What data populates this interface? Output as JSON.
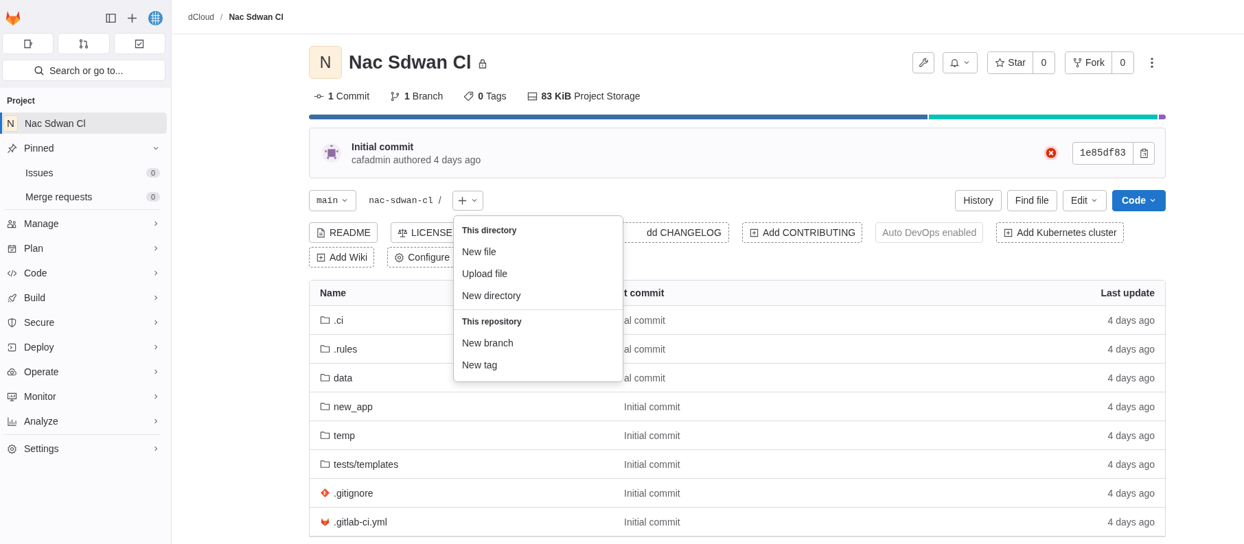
{
  "sidebar": {
    "search": {
      "placeholder": "Search or go to..."
    },
    "section": "Project",
    "project": {
      "initial": "N",
      "name": "Nac Sdwan Cl",
      "selected": true
    },
    "pinned": {
      "label": "Pinned",
      "expanded": true,
      "items": [
        {
          "label": "Issues",
          "count": "0"
        },
        {
          "label": "Merge requests",
          "count": "0"
        }
      ]
    },
    "groups": [
      {
        "label": "Manage"
      },
      {
        "label": "Plan"
      },
      {
        "label": "Code"
      },
      {
        "label": "Build"
      },
      {
        "label": "Secure"
      },
      {
        "label": "Deploy"
      },
      {
        "label": "Operate"
      },
      {
        "label": "Monitor"
      },
      {
        "label": "Analyze"
      }
    ],
    "settings": {
      "label": "Settings"
    }
  },
  "breadcrumb": {
    "items": [
      "dCloud",
      "Nac Sdwan Cl"
    ],
    "separator": "/"
  },
  "project": {
    "initial": "N",
    "name": "Nac Sdwan Cl",
    "private": true,
    "star": {
      "label": "Star",
      "count": "0"
    },
    "fork": {
      "label": "Fork",
      "count": "0"
    }
  },
  "stats": [
    {
      "count": "1",
      "label": "Commit"
    },
    {
      "count": "1",
      "label": "Branch"
    },
    {
      "count": "0",
      "label": "Tags"
    },
    {
      "count": "83 KiB",
      "label": "Project Storage"
    }
  ],
  "languages": [
    {
      "color": "#3a6ea5"
    },
    {
      "color": "#06c2b8"
    },
    {
      "color": "#8d5ec9"
    }
  ],
  "commit": {
    "title": "Initial commit",
    "byline": "cafadmin authored 4 days ago",
    "pipeline_failed": true,
    "sha": "1e85df83"
  },
  "branch": {
    "name": "main",
    "path": "nac-sdwan-cl",
    "separator": "/"
  },
  "toolbar": [
    {
      "label": "History",
      "kind": "plain"
    },
    {
      "label": "Find file",
      "kind": "plain"
    },
    {
      "label": "Edit",
      "kind": "dropdown"
    },
    {
      "label": "Code",
      "kind": "primary"
    }
  ],
  "shortcuts": [
    [
      {
        "label": "README",
        "kind": "readme"
      },
      {
        "label": "LICENSE",
        "kind": "license"
      },
      {
        "label": "dd CHANGELOG",
        "kind": "cut"
      },
      {
        "label": "Add CONTRIBUTING",
        "kind": "add"
      },
      {
        "label": "Auto DevOps enabled",
        "kind": "plain"
      },
      {
        "label": "Add Kubernetes cluster",
        "kind": "add"
      }
    ],
    [
      {
        "label": "Add Wiki",
        "kind": "add"
      },
      {
        "label": "Configure",
        "kind": "settings"
      }
    ]
  ],
  "menu": {
    "sections": [
      {
        "title": "This directory",
        "items": [
          "New file",
          "Upload file",
          "New directory"
        ]
      },
      {
        "title": "This repository",
        "items": [
          "New branch",
          "New tag"
        ]
      }
    ]
  },
  "table": {
    "columns": [
      "Name",
      "t commit",
      "Last update"
    ],
    "rows": [
      {
        "name": ".ci",
        "kind": "folder",
        "commit": "al commit",
        "updated": "4 days ago"
      },
      {
        "name": ".rules",
        "kind": "folder",
        "commit": "al commit",
        "updated": "4 days ago"
      },
      {
        "name": "data",
        "kind": "folder",
        "commit": "al commit",
        "updated": "4 days ago"
      },
      {
        "name": "new_app",
        "kind": "folder",
        "commit": "Initial commit",
        "updated": "4 days ago"
      },
      {
        "name": "temp",
        "kind": "folder",
        "commit": "Initial commit",
        "updated": "4 days ago"
      },
      {
        "name": "tests/templates",
        "kind": "folder",
        "commit": "Initial commit",
        "updated": "4 days ago"
      },
      {
        "name": ".gitignore",
        "kind": "git",
        "commit": "Initial commit",
        "updated": "4 days ago"
      },
      {
        "name": ".gitlab-ci.yml",
        "kind": "gitlab",
        "commit": "Initial commit",
        "updated": "4 days ago"
      }
    ]
  }
}
